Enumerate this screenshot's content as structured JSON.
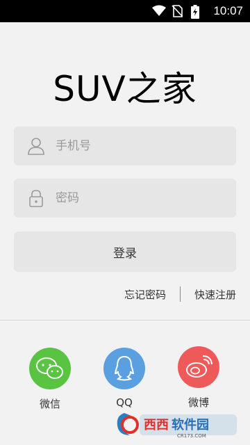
{
  "status_bar": {
    "time": "10:07",
    "icons": [
      "wifi-icon",
      "no-sim-icon",
      "battery-charging-icon"
    ]
  },
  "app": {
    "title": "SUV之家"
  },
  "login_form": {
    "phone_placeholder": "手机号",
    "password_placeholder": "密码",
    "login_label": "登录",
    "forgot_password": "忘记密码",
    "quick_register": "快速注册"
  },
  "social_login": [
    {
      "label": "微信",
      "icon": "wechat-icon",
      "color": "#58c442"
    },
    {
      "label": "QQ",
      "icon": "qq-icon",
      "color": "#5a9fe0"
    },
    {
      "label": "微博",
      "icon": "weibo-icon",
      "color": "#ee5a5a"
    }
  ],
  "watermark": {
    "text": "西西软件园",
    "subtext": "CR173.COM"
  },
  "colors": {
    "background": "#f2f2f2",
    "field": "#e6e6e6",
    "status_bar": "#000000"
  }
}
